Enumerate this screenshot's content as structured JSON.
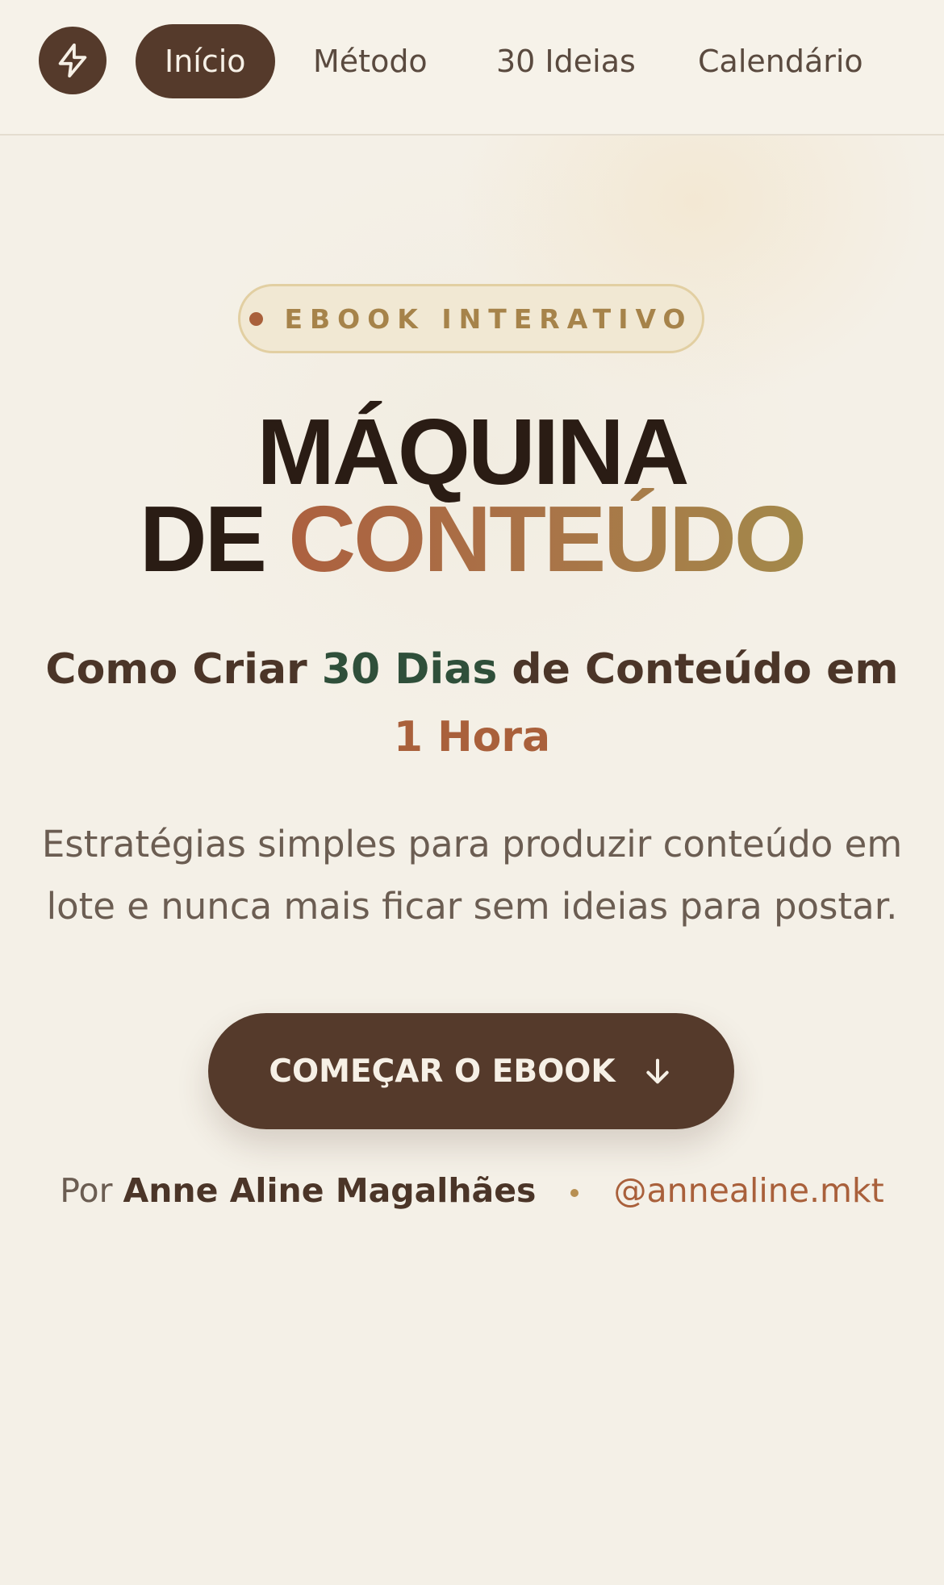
{
  "nav": {
    "logo_icon": "lightning-bolt-icon",
    "items": [
      {
        "label": "Início",
        "active": true
      },
      {
        "label": "Método",
        "active": false
      },
      {
        "label": "30 Ideias",
        "active": false
      },
      {
        "label": "Calendário",
        "active": false
      }
    ]
  },
  "hero": {
    "badge": "EBOOK INTERATIVO",
    "title_line1": "MÁQUINA",
    "title_line2_dark": "DE",
    "title_line2_accent": "CONTEÚDO",
    "subtitle": {
      "part1": "Como Criar",
      "highlight1": "30 Dias",
      "part2": "de Conteúdo em",
      "highlight2": "1 Hora"
    },
    "description": "Estratégias simples para produzir conteúdo em lote e nunca mais ficar sem ideias para postar.",
    "cta_label": "COMEÇAR O EBOOK",
    "cta_icon": "arrow-down-icon",
    "byline": {
      "prefix": "Por",
      "author": "Anne Aline Magalhães",
      "handle": "@annealine.mkt"
    }
  },
  "colors": {
    "background": "#f4f0e7",
    "primary_brown": "#553a2b",
    "accent_rust": "#a9603b",
    "accent_gold": "#a6834a",
    "accent_green": "#2f4f3a"
  }
}
